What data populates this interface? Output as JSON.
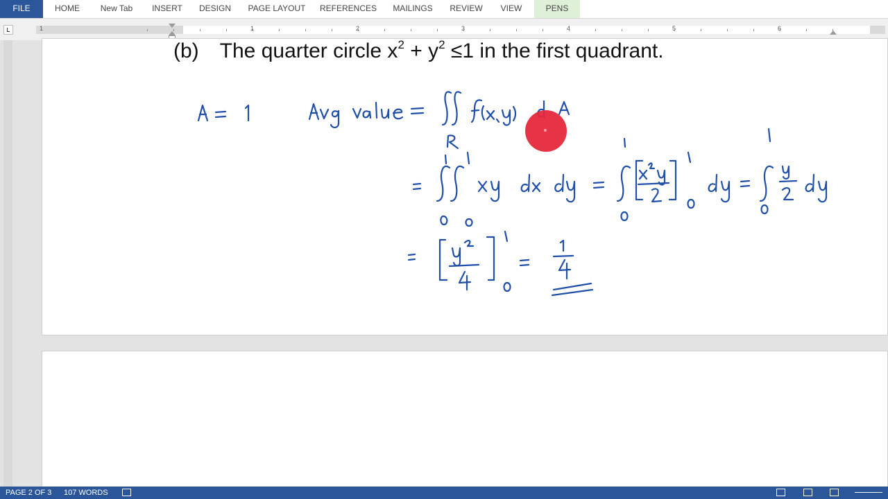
{
  "ribbon": {
    "tabs": [
      {
        "label": "FILE"
      },
      {
        "label": "HOME"
      },
      {
        "label": "New Tab"
      },
      {
        "label": "INSERT"
      },
      {
        "label": "DESIGN"
      },
      {
        "label": "PAGE LAYOUT"
      },
      {
        "label": "REFERENCES"
      },
      {
        "label": "MAILINGS"
      },
      {
        "label": "REVIEW"
      },
      {
        "label": "VIEW"
      },
      {
        "label": "PENS"
      }
    ]
  },
  "ruler": {
    "numbers": [
      "1",
      "1",
      "2",
      "3",
      "4",
      "5",
      "6"
    ]
  },
  "document": {
    "heading": {
      "label": "(b)",
      "part1": "The quarter circle x",
      "sup1": "2",
      "part2": " + y",
      "sup2": "2",
      "part3": " ≤1 in the first quadrant."
    },
    "ink_color": "#1f4fa8"
  },
  "status": {
    "page": "PAGE 2 OF 3",
    "words": "107 WORDS"
  },
  "colors": {
    "accent": "#2b579a",
    "pens_tab": "#dff0d8",
    "laser_pointer": "#e5263a"
  }
}
